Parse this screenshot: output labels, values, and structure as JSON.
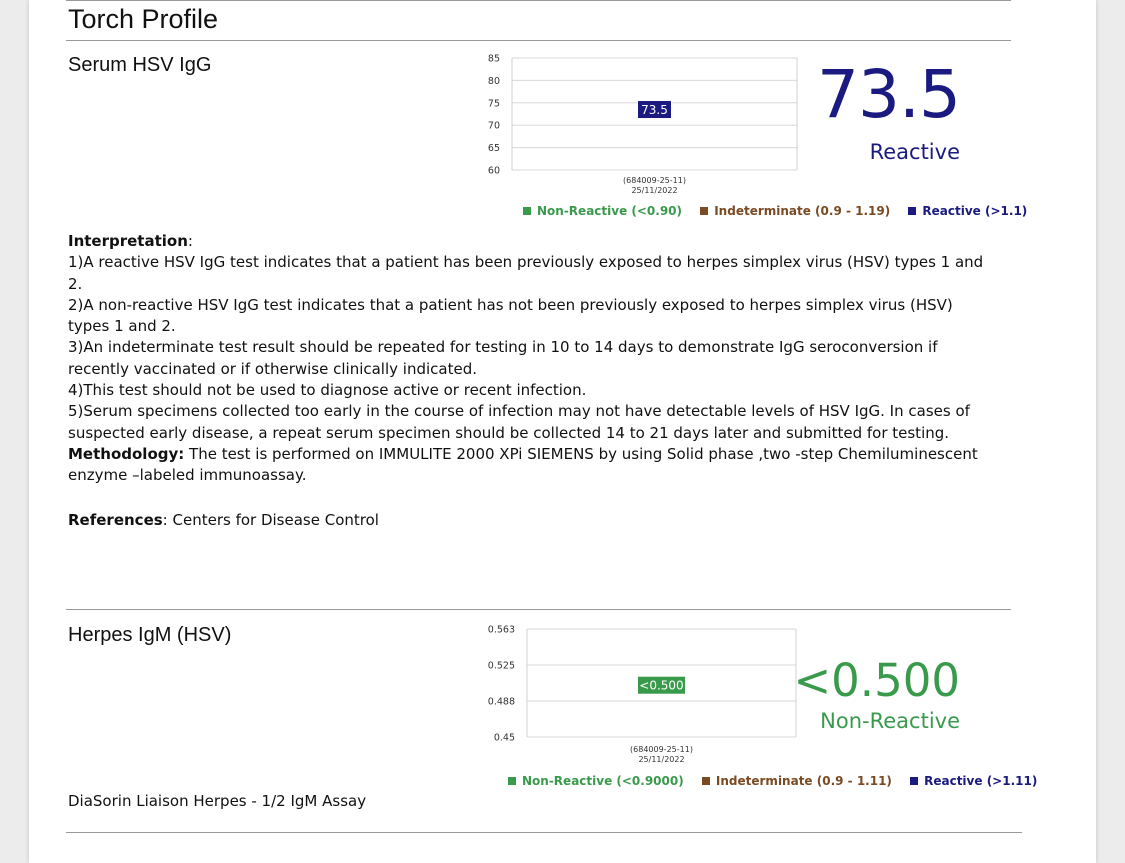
{
  "page_title": "Torch Profile",
  "colors": {
    "reactive": "#1a1a80",
    "non_reactive": "#3a9a4c",
    "indeterminate": "#7a4a22"
  },
  "tests": [
    {
      "name": "Serum HSV IgG",
      "value_display": "73.5",
      "status": "Reactive",
      "footer": "",
      "legend": [
        "Non-Reactive (<0.90)",
        "Indeterminate (0.9 - 1.19)",
        "Reactive (>1.1)"
      ],
      "chart_data": {
        "type": "scatter",
        "categories": [
          "(684009-25-11)\n25/11/2022"
        ],
        "x_label_line1": "(684009-25-11)",
        "x_label_line2": "25/11/2022",
        "values": [
          73.5
        ],
        "data_labels": [
          "73.5"
        ],
        "y_ticks": [
          "85",
          "80",
          "75",
          "70",
          "65",
          "60"
        ],
        "ylim": [
          60,
          85
        ],
        "grid": true,
        "legend_placement": "bottom",
        "series_color": "#1a1a80"
      }
    },
    {
      "name": "Herpes IgM (HSV)",
      "value_display": "<0.500",
      "status": "Non-Reactive",
      "footer": "DiaSorin Liaison Herpes - 1/2 IgM Assay",
      "legend": [
        "Non-Reactive (<0.9000)",
        "Indeterminate (0.9 - 1.11)",
        "Reactive (>1.11)"
      ],
      "chart_data": {
        "type": "scatter",
        "categories": [
          "(684009-25-11)\n25/11/2022"
        ],
        "x_label_line1": "(684009-25-11)",
        "x_label_line2": "25/11/2022",
        "values": [
          0.5
        ],
        "data_labels": [
          "<0.500"
        ],
        "y_ticks": [
          "0.563",
          "0.525",
          "0.488",
          "0.45"
        ],
        "ylim": [
          0.45,
          0.563
        ],
        "grid": true,
        "legend_placement": "bottom",
        "series_color": "#3a9a4c"
      }
    }
  ],
  "interpretation": {
    "heading": "Interpretation",
    "heading_suffix": ":",
    "points": [
      "1)A reactive HSV IgG test indicates that a patient has been previously exposed to herpes simplex virus (HSV) types 1 and 2.",
      "2)A non-reactive HSV IgG test indicates that a patient has not been previously exposed to herpes simplex virus (HSV) types 1 and 2.",
      "3)An indeterminate test result should be repeated for testing in 10 to 14 days to demonstrate IgG seroconversion if recently vaccinated or if otherwise clinically indicated.",
      "4)This test should not be used to diagnose active or recent infection.",
      "5)Serum specimens collected too early in the course of infection may not have detectable levels of HSV IgG. In cases of suspected early disease, a repeat serum specimen should be collected 14 to 21 days later and submitted for testing."
    ]
  },
  "methodology": {
    "label": "Methodology:",
    "text": " The test is performed on IMMULITE 2000 XPi SIEMENS by using Solid phase ,two -step Chemiluminescent enzyme –labeled immunoassay."
  },
  "references": {
    "label": "References",
    "text": ": Centers for Disease Control"
  }
}
